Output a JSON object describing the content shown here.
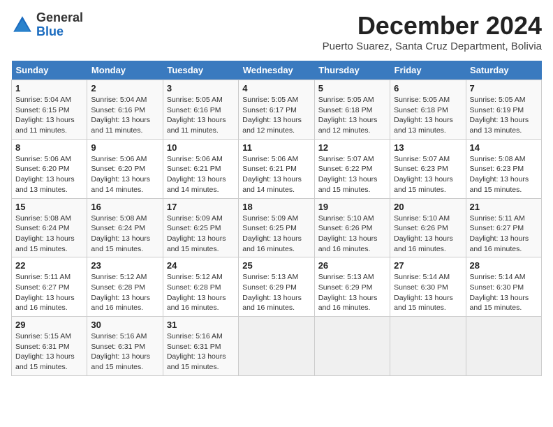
{
  "header": {
    "logo_general": "General",
    "logo_blue": "Blue",
    "month_title": "December 2024",
    "location": "Puerto Suarez, Santa Cruz Department, Bolivia"
  },
  "days_of_week": [
    "Sunday",
    "Monday",
    "Tuesday",
    "Wednesday",
    "Thursday",
    "Friday",
    "Saturday"
  ],
  "weeks": [
    [
      {
        "day": 1,
        "sunrise": "5:04 AM",
        "sunset": "6:15 PM",
        "daylight": "13 hours and 11 minutes."
      },
      {
        "day": 2,
        "sunrise": "5:04 AM",
        "sunset": "6:16 PM",
        "daylight": "13 hours and 11 minutes."
      },
      {
        "day": 3,
        "sunrise": "5:05 AM",
        "sunset": "6:16 PM",
        "daylight": "13 hours and 11 minutes."
      },
      {
        "day": 4,
        "sunrise": "5:05 AM",
        "sunset": "6:17 PM",
        "daylight": "13 hours and 12 minutes."
      },
      {
        "day": 5,
        "sunrise": "5:05 AM",
        "sunset": "6:18 PM",
        "daylight": "13 hours and 12 minutes."
      },
      {
        "day": 6,
        "sunrise": "5:05 AM",
        "sunset": "6:18 PM",
        "daylight": "13 hours and 13 minutes."
      },
      {
        "day": 7,
        "sunrise": "5:05 AM",
        "sunset": "6:19 PM",
        "daylight": "13 hours and 13 minutes."
      }
    ],
    [
      {
        "day": 8,
        "sunrise": "5:06 AM",
        "sunset": "6:20 PM",
        "daylight": "13 hours and 13 minutes."
      },
      {
        "day": 9,
        "sunrise": "5:06 AM",
        "sunset": "6:20 PM",
        "daylight": "13 hours and 14 minutes."
      },
      {
        "day": 10,
        "sunrise": "5:06 AM",
        "sunset": "6:21 PM",
        "daylight": "13 hours and 14 minutes."
      },
      {
        "day": 11,
        "sunrise": "5:06 AM",
        "sunset": "6:21 PM",
        "daylight": "13 hours and 14 minutes."
      },
      {
        "day": 12,
        "sunrise": "5:07 AM",
        "sunset": "6:22 PM",
        "daylight": "13 hours and 15 minutes."
      },
      {
        "day": 13,
        "sunrise": "5:07 AM",
        "sunset": "6:23 PM",
        "daylight": "13 hours and 15 minutes."
      },
      {
        "day": 14,
        "sunrise": "5:08 AM",
        "sunset": "6:23 PM",
        "daylight": "13 hours and 15 minutes."
      }
    ],
    [
      {
        "day": 15,
        "sunrise": "5:08 AM",
        "sunset": "6:24 PM",
        "daylight": "13 hours and 15 minutes."
      },
      {
        "day": 16,
        "sunrise": "5:08 AM",
        "sunset": "6:24 PM",
        "daylight": "13 hours and 15 minutes."
      },
      {
        "day": 17,
        "sunrise": "5:09 AM",
        "sunset": "6:25 PM",
        "daylight": "13 hours and 15 minutes."
      },
      {
        "day": 18,
        "sunrise": "5:09 AM",
        "sunset": "6:25 PM",
        "daylight": "13 hours and 16 minutes."
      },
      {
        "day": 19,
        "sunrise": "5:10 AM",
        "sunset": "6:26 PM",
        "daylight": "13 hours and 16 minutes."
      },
      {
        "day": 20,
        "sunrise": "5:10 AM",
        "sunset": "6:26 PM",
        "daylight": "13 hours and 16 minutes."
      },
      {
        "day": 21,
        "sunrise": "5:11 AM",
        "sunset": "6:27 PM",
        "daylight": "13 hours and 16 minutes."
      }
    ],
    [
      {
        "day": 22,
        "sunrise": "5:11 AM",
        "sunset": "6:27 PM",
        "daylight": "13 hours and 16 minutes."
      },
      {
        "day": 23,
        "sunrise": "5:12 AM",
        "sunset": "6:28 PM",
        "daylight": "13 hours and 16 minutes."
      },
      {
        "day": 24,
        "sunrise": "5:12 AM",
        "sunset": "6:28 PM",
        "daylight": "13 hours and 16 minutes."
      },
      {
        "day": 25,
        "sunrise": "5:13 AM",
        "sunset": "6:29 PM",
        "daylight": "13 hours and 16 minutes."
      },
      {
        "day": 26,
        "sunrise": "5:13 AM",
        "sunset": "6:29 PM",
        "daylight": "13 hours and 16 minutes."
      },
      {
        "day": 27,
        "sunrise": "5:14 AM",
        "sunset": "6:30 PM",
        "daylight": "13 hours and 15 minutes."
      },
      {
        "day": 28,
        "sunrise": "5:14 AM",
        "sunset": "6:30 PM",
        "daylight": "13 hours and 15 minutes."
      }
    ],
    [
      {
        "day": 29,
        "sunrise": "5:15 AM",
        "sunset": "6:31 PM",
        "daylight": "13 hours and 15 minutes."
      },
      {
        "day": 30,
        "sunrise": "5:16 AM",
        "sunset": "6:31 PM",
        "daylight": "13 hours and 15 minutes."
      },
      {
        "day": 31,
        "sunrise": "5:16 AM",
        "sunset": "6:31 PM",
        "daylight": "13 hours and 15 minutes."
      },
      null,
      null,
      null,
      null
    ]
  ]
}
